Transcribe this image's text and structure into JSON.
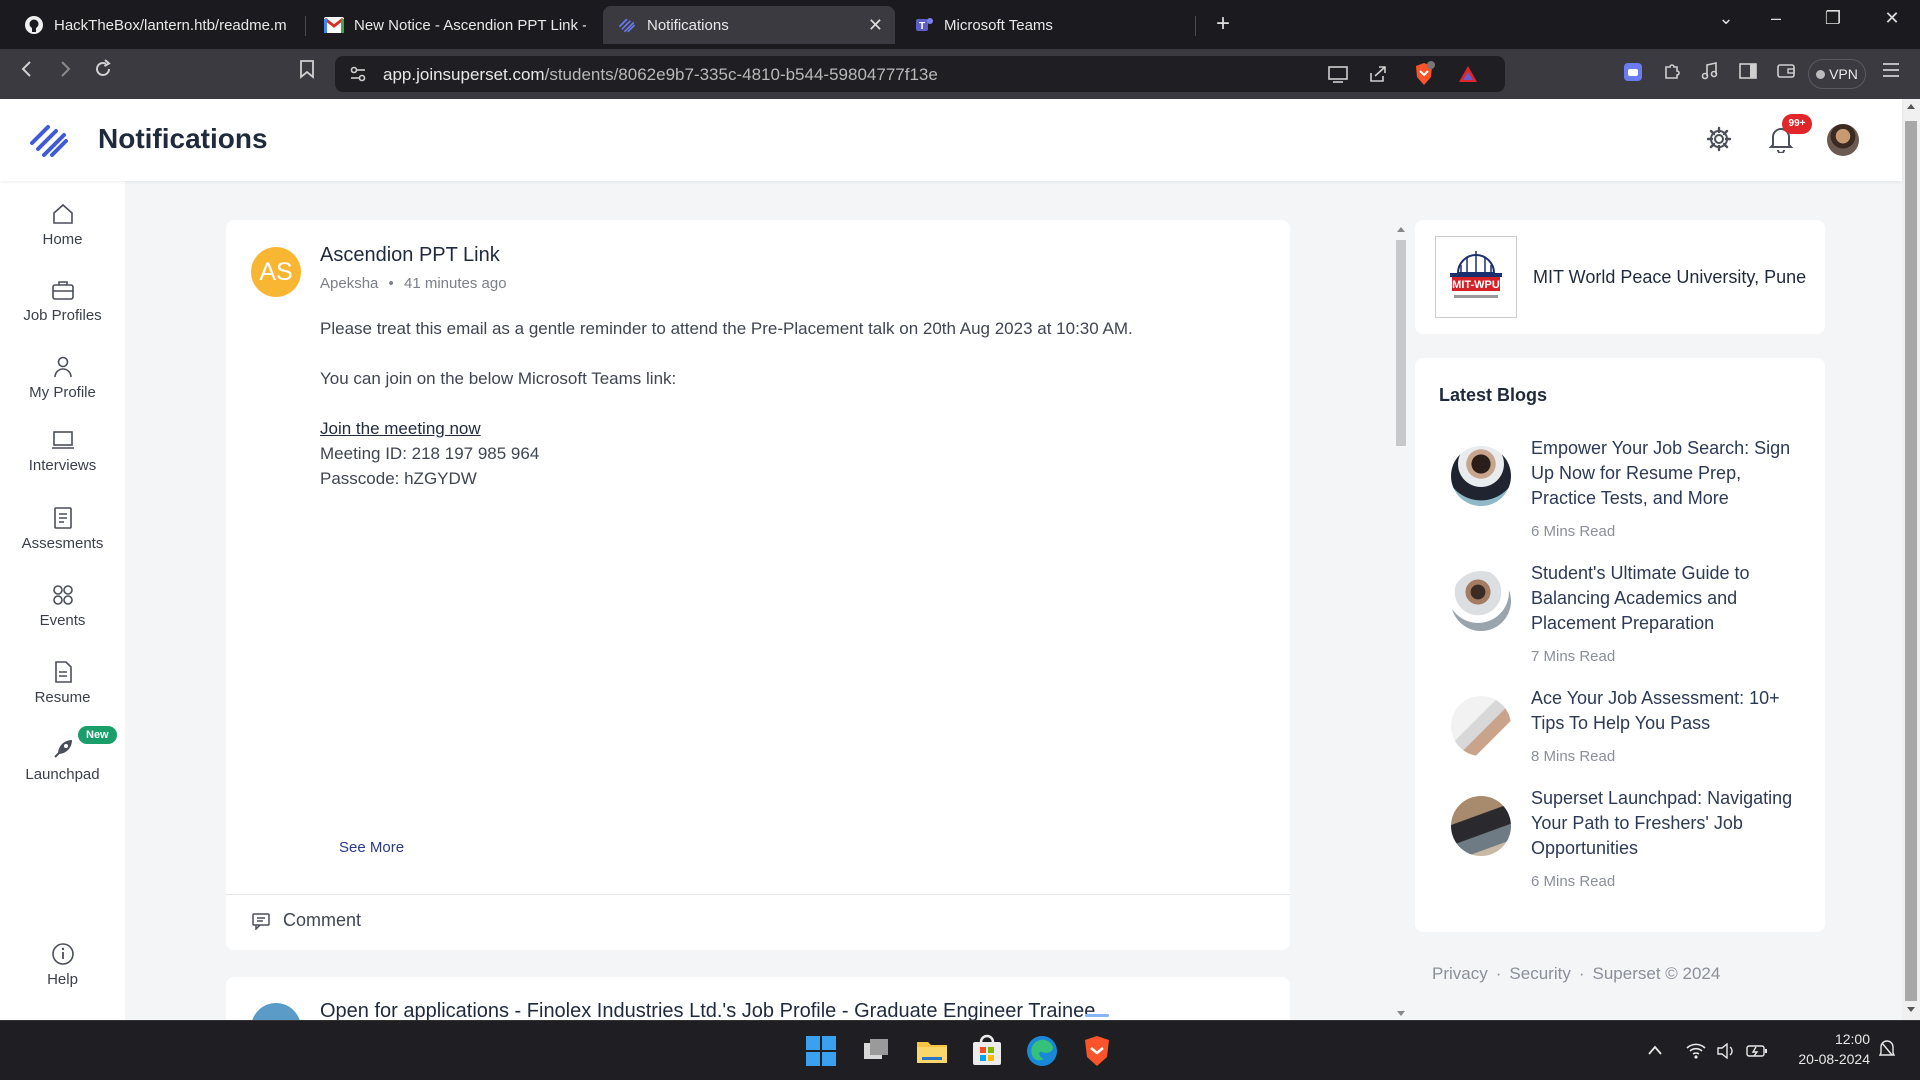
{
  "browser": {
    "tabs": [
      {
        "label": "HackTheBox/lantern.htb/readme.md",
        "icon": "github-icon"
      },
      {
        "label": "New Notice - Ascendion PPT Link -",
        "icon": "gmail-icon"
      },
      {
        "label": "Notifications",
        "icon": "superset-icon",
        "active": true
      },
      {
        "label": "Microsoft Teams",
        "icon": "teams-icon"
      }
    ],
    "url_host": "app.joinsuperset.com",
    "url_path": "/students/8062e9b7-335c-4810-b544-59804777f13e",
    "vpn_label": "VPN"
  },
  "app": {
    "title": "Notifications",
    "notification_badge": "99+",
    "colors": {
      "accent": "#3f5bd6",
      "avatar": "#f9b633",
      "new_pill": "#1a9e6a",
      "badge": "#e0252b"
    }
  },
  "sidebar": {
    "items": [
      {
        "label": "Home",
        "icon": "home-icon"
      },
      {
        "label": "Job Profiles",
        "icon": "briefcase-icon"
      },
      {
        "label": "My Profile",
        "icon": "user-icon"
      },
      {
        "label": "Interviews",
        "icon": "laptop-icon"
      },
      {
        "label": "Assesments",
        "icon": "document-icon"
      },
      {
        "label": "Events",
        "icon": "grid-icon"
      },
      {
        "label": "Resume",
        "icon": "file-icon"
      },
      {
        "label": "Launchpad",
        "icon": "rocket-icon",
        "badge": "New"
      }
    ],
    "help_label": "Help"
  },
  "post": {
    "avatar_initials": "AS",
    "title": "Ascendion PPT Link",
    "author": "Apeksha",
    "time": "41 minutes ago",
    "line1": "Please treat this email as a gentle reminder to attend the Pre-Placement talk on 20th Aug 2023 at 10:30 AM.",
    "line2": "You can join on the below Microsoft Teams link:",
    "link_text": "Join the meeting now",
    "meeting_id": "Meeting ID: 218 197 985 964",
    "passcode": "Passcode: hZGYDW",
    "see_more": "See More",
    "comment_label": "Comment"
  },
  "next_post": {
    "title": "Open for applications - Finolex Industries Ltd.'s Job Profile - Graduate Engineer Trainee"
  },
  "university": {
    "name": "MIT World Peace University, Pune",
    "logo_text": "MIT-WPU"
  },
  "blogs": {
    "heading": "Latest Blogs",
    "items": [
      {
        "title": "Empower Your Job Search: Sign Up Now for Resume Prep, Practice Tests, and More",
        "read": "6 Mins Read"
      },
      {
        "title": "Student's Ultimate Guide to Balancing Academics and Placement Preparation",
        "read": "7 Mins Read"
      },
      {
        "title": "Ace Your Job Assessment: 10+ Tips To Help You Pass",
        "read": "8 Mins Read"
      },
      {
        "title": "Superset Launchpad: Navigating Your Path to Freshers' Job Opportunities",
        "read": "6 Mins Read"
      }
    ]
  },
  "footer": {
    "privacy": "Privacy",
    "security": "Security",
    "copyright": "Superset © 2024",
    "sep": "·"
  },
  "taskbar": {
    "time": "12:00",
    "date": "20-08-2024"
  }
}
